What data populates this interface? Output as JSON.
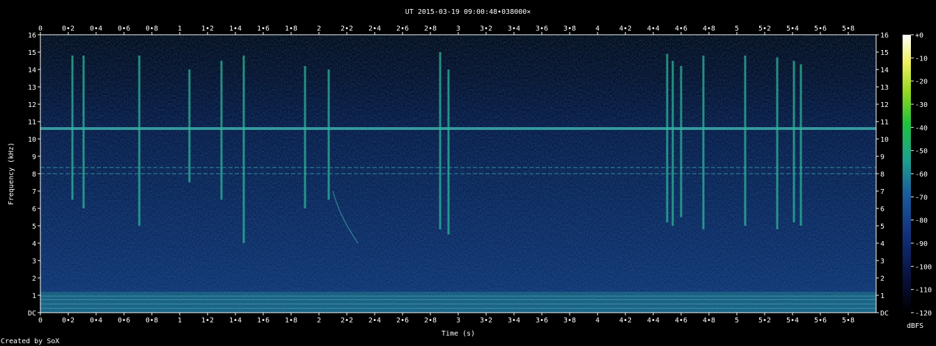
{
  "chart_data": {
    "type": "heatmap",
    "title": "UT 2015-03-19 09:00:48•038000×",
    "xlabel": "Time (s)",
    "ylabel": "Frequency (kHz)",
    "xlim": [
      0,
      6
    ],
    "ylim": [
      0,
      16
    ],
    "x_ticks": [
      "0",
      "0•2",
      "0•4",
      "0•6",
      "0•8",
      "1",
      "1•2",
      "1•4",
      "1•6",
      "1•8",
      "2",
      "2•2",
      "2•4",
      "2•6",
      "2•8",
      "3",
      "3•2",
      "3•4",
      "3•6",
      "3•8",
      "4",
      "4•2",
      "4•4",
      "4•6",
      "4•8",
      "5",
      "5•2",
      "5•4",
      "5•6",
      "5•8"
    ],
    "y_ticks": [
      "DC",
      "1",
      "2",
      "3",
      "4",
      "5",
      "6",
      "7",
      "8",
      "9",
      "10",
      "11",
      "12",
      "13",
      "14",
      "15",
      "16"
    ],
    "colorbar": {
      "label": "dBFS",
      "range": [
        -120,
        0
      ],
      "ticks": [
        "+0",
        "-10",
        "-20",
        "-30",
        "-40",
        "-50",
        "-60",
        "-70",
        "-80",
        "-90",
        "-100",
        "-110",
        "-120"
      ]
    },
    "features": {
      "persistent_tones_khz": [
        10.6,
        8.35,
        8.0
      ],
      "low_frequency_band_khz": [
        0,
        1.2
      ],
      "broadband_impulses": [
        {
          "t": 0.23,
          "f_low": 6.5,
          "f_high": 14.8
        },
        {
          "t": 0.31,
          "f_low": 6.0,
          "f_high": 14.8
        },
        {
          "t": 0.71,
          "f_low": 5.0,
          "f_high": 14.8
        },
        {
          "t": 1.07,
          "f_low": 7.5,
          "f_high": 14.0
        },
        {
          "t": 1.3,
          "f_low": 6.5,
          "f_high": 14.5
        },
        {
          "t": 1.46,
          "f_low": 4.0,
          "f_high": 14.8
        },
        {
          "t": 1.9,
          "f_low": 6.0,
          "f_high": 14.2
        },
        {
          "t": 2.07,
          "f_low": 6.5,
          "f_high": 14.0
        },
        {
          "t": 2.87,
          "f_low": 4.8,
          "f_high": 15.0
        },
        {
          "t": 2.93,
          "f_low": 4.5,
          "f_high": 14.0
        },
        {
          "t": 4.5,
          "f_low": 5.2,
          "f_high": 14.9
        },
        {
          "t": 4.54,
          "f_low": 5.0,
          "f_high": 14.5
        },
        {
          "t": 4.6,
          "f_low": 5.5,
          "f_high": 14.2
        },
        {
          "t": 4.76,
          "f_low": 4.8,
          "f_high": 14.8
        },
        {
          "t": 5.06,
          "f_low": 5.0,
          "f_high": 14.8
        },
        {
          "t": 5.29,
          "f_low": 4.8,
          "f_high": 14.7
        },
        {
          "t": 5.41,
          "f_low": 5.2,
          "f_high": 14.5
        },
        {
          "t": 5.46,
          "f_low": 5.0,
          "f_high": 14.3
        }
      ],
      "sweep": {
        "t_start": 2.1,
        "f_start": 7.0,
        "t_end": 2.28,
        "f_end": 4.0
      }
    },
    "colors": {
      "background": "#000000",
      "floor": "#0a1a4a",
      "tone": "#3aa6a6",
      "impulse": "#2eb89a",
      "text": "#ffffff"
    }
  },
  "footer": {
    "credit": "Created by SoX"
  }
}
